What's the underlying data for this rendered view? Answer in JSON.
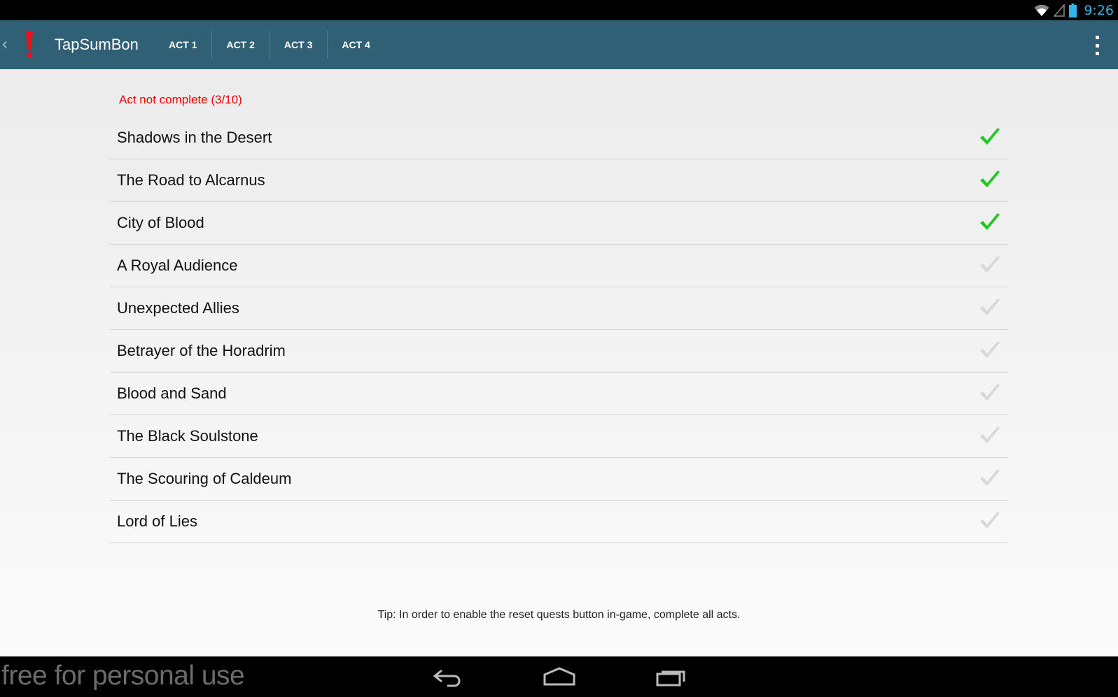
{
  "status_bar": {
    "time": "9:26",
    "icons": [
      "wifi-icon",
      "signal-icon",
      "battery-icon"
    ],
    "accent_color": "#33b5e5"
  },
  "action_bar": {
    "background_color": "#2f6075",
    "app_title": "TapSumBon",
    "app_icon": "exclamation-icon",
    "tabs": [
      {
        "label": "ACT 1"
      },
      {
        "label": "ACT 2"
      },
      {
        "label": "ACT 3"
      },
      {
        "label": "ACT 4"
      }
    ],
    "overflow_icon": "overflow-menu-icon"
  },
  "main": {
    "act_status": "Act not complete (3/10)",
    "act_status_color": "#ee0000",
    "quests": [
      {
        "name": "Shadows in the Desert",
        "completed": true
      },
      {
        "name": "The Road to Alcarnus",
        "completed": true
      },
      {
        "name": "City of Blood",
        "completed": true
      },
      {
        "name": "A Royal Audience",
        "completed": false
      },
      {
        "name": "Unexpected Allies",
        "completed": false
      },
      {
        "name": "Betrayer of the Horadrim",
        "completed": false
      },
      {
        "name": "Blood and Sand",
        "completed": false
      },
      {
        "name": "The Black Soulstone",
        "completed": false
      },
      {
        "name": "The Scouring of Caldeum",
        "completed": false
      },
      {
        "name": "Lord of Lies",
        "completed": false
      }
    ],
    "check_color_complete": "#1ec81e",
    "check_color_incomplete": "#d8d8d8",
    "tip": "Tip: In order to enable the reset quests button in-game, complete all acts."
  },
  "nav_bar": {
    "watermark": "free for personal use",
    "buttons": [
      "back-icon",
      "home-icon",
      "recent-apps-icon"
    ]
  }
}
